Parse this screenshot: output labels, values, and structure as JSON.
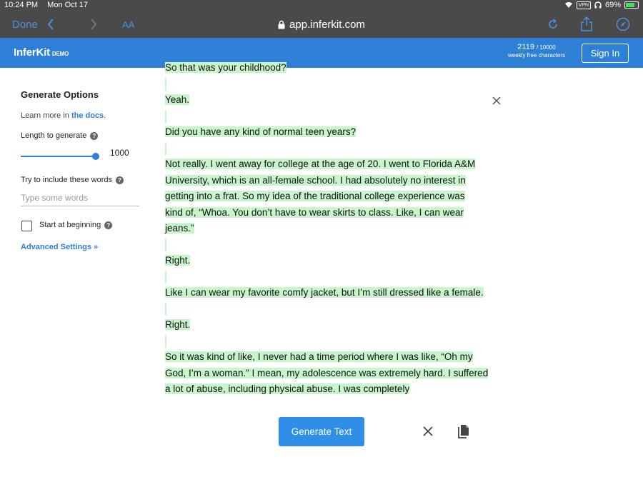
{
  "status_bar": {
    "time": "10:24 PM",
    "date": "Mon Oct 17",
    "vpn": "VPN",
    "battery": "69%"
  },
  "browser": {
    "done_label": "Done",
    "text_size_label": "AA",
    "url": "app.inferkit.com",
    "icons": [
      "chevron-left-icon",
      "chevron-right-icon",
      "lock-icon",
      "reload-icon",
      "share-icon",
      "compass-icon"
    ]
  },
  "header": {
    "logo": "InferKit",
    "logo_tag": "DEMO",
    "chars_used": "2119",
    "chars_total": "/ 10000",
    "chars_sub": "weekly free characters",
    "signin_label": "Sign In",
    "brand_color": "#2e7fd6"
  },
  "sidebar": {
    "title": "Generate Options",
    "learn_prefix": "Learn more in ",
    "learn_link": "the docs",
    "learn_suffix": ".",
    "length_label": "Length to generate",
    "length_value": "1000",
    "length_fraction": 1.0,
    "words_label": "Try to include these words",
    "words_placeholder": "Type some words",
    "start_label": "Start at beginning",
    "start_checked": false,
    "advanced_label": "Advanced Settings »"
  },
  "document": {
    "lines": [
      "So that was your childhood?",
      "",
      "Yeah.",
      "",
      "Did you have any kind of normal teen years?",
      "",
      "Not really. I went away for college at the age of 20. I went to Florida A&M",
      "University, which is an all-female school. I had absolutely no interest in",
      "getting into a frat. So my idea of the traditional college experience was",
      "kind of, “Whoa. You don’t have to wear skirts to class. Like, I can wear",
      "jeans.”",
      "",
      "Right.",
      "",
      "Like I can wear my favorite comfy jacket, but I’m still dressed like a female.",
      "",
      "Right.",
      "",
      "So it was kind of like, I never had a time period where I was like, “Oh my",
      "God, I’m a woman.” I mean, my adolescence was extremely hard. I suffered",
      "a lot of abuse, including physical abuse. I was completely"
    ],
    "highlight_color": "#c8f5cc"
  },
  "actions": {
    "generate_label": "Generate Text"
  }
}
